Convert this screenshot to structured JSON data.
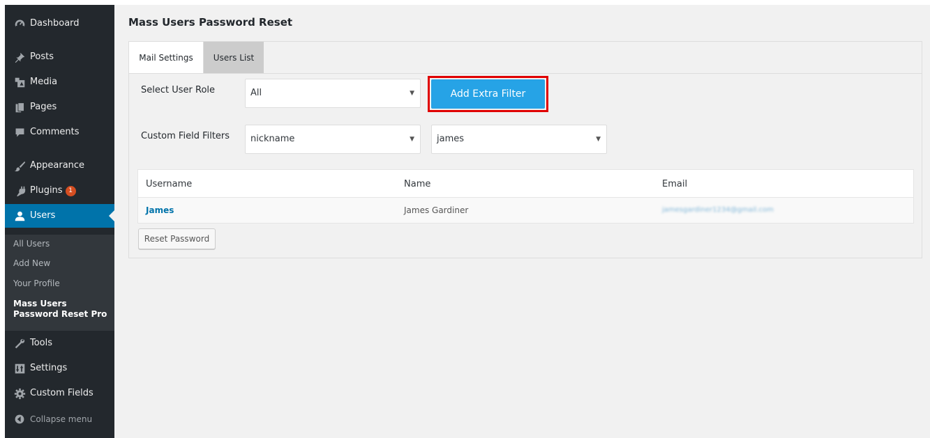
{
  "sidebar": {
    "items": [
      {
        "label": "Dashboard",
        "icon": "dashboard-icon"
      },
      {
        "label": "Posts",
        "icon": "pushpin-icon"
      },
      {
        "label": "Media",
        "icon": "media-icon"
      },
      {
        "label": "Pages",
        "icon": "pages-icon"
      },
      {
        "label": "Comments",
        "icon": "comment-icon"
      },
      {
        "label": "Appearance",
        "icon": "paintbrush-icon"
      },
      {
        "label": "Plugins",
        "icon": "plugin-icon",
        "badge": "1"
      },
      {
        "label": "Users",
        "icon": "users-icon",
        "active": true
      },
      {
        "label": "Tools",
        "icon": "wrench-icon"
      },
      {
        "label": "Settings",
        "icon": "settings-icon"
      },
      {
        "label": "Custom Fields",
        "icon": "gear-icon"
      },
      {
        "label": "Collapse menu",
        "icon": "collapse-icon"
      }
    ],
    "submenu": [
      {
        "label": "All Users"
      },
      {
        "label": "Add New"
      },
      {
        "label": "Your Profile"
      },
      {
        "label": "Mass Users Password Reset Pro",
        "current": true
      }
    ]
  },
  "page": {
    "title": "Mass Users Password Reset",
    "tabs": [
      {
        "label": "Mail Settings"
      },
      {
        "label": "Users List",
        "active": true
      }
    ]
  },
  "filters": {
    "role_label": "Select User Role",
    "role_value": "All",
    "add_filter_label": "Add Extra Filter",
    "custom_label": "Custom Field Filters",
    "field_value": "nickname",
    "value_value": "james"
  },
  "table": {
    "headers": [
      "Username",
      "Name",
      "Email"
    ],
    "rows": [
      {
        "username": "James",
        "name": "James Gardiner",
        "email": "jamesgardiner1234@gmail.com"
      }
    ]
  },
  "actions": {
    "reset_label": "Reset Password"
  },
  "colors": {
    "sidebar_bg": "#23282d",
    "accent": "#0073aa",
    "button_blue": "#26a3e6",
    "highlight_red": "#e00000",
    "badge": "#d54e21"
  }
}
